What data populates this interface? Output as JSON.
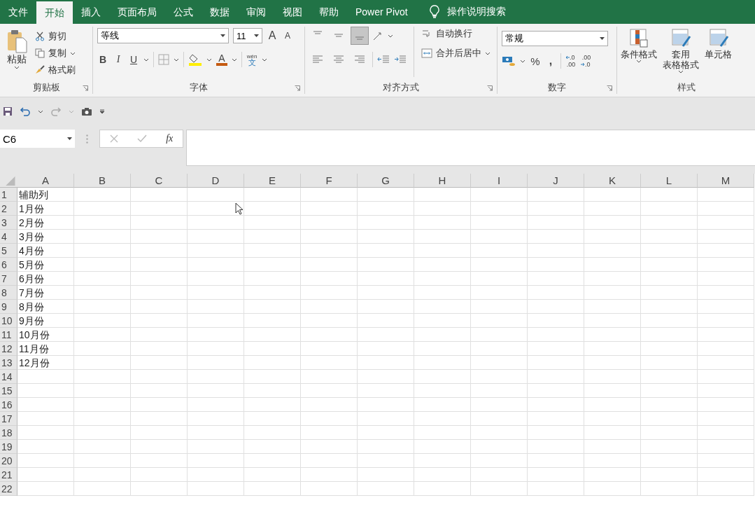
{
  "tabs": [
    {
      "label": "文件",
      "selected": false
    },
    {
      "label": "开始",
      "selected": true
    },
    {
      "label": "插入",
      "selected": false
    },
    {
      "label": "页面布局",
      "selected": false
    },
    {
      "label": "公式",
      "selected": false
    },
    {
      "label": "数据",
      "selected": false
    },
    {
      "label": "审阅",
      "selected": false
    },
    {
      "label": "视图",
      "selected": false
    },
    {
      "label": "帮助",
      "selected": false
    },
    {
      "label": "Power Pivot",
      "selected": false
    }
  ],
  "tell_me": {
    "text": "操作说明搜索"
  },
  "ribbon": {
    "clipboard": {
      "paste": "粘贴",
      "items": [
        "剪切",
        "复制",
        "格式刷"
      ],
      "title": "剪贴板"
    },
    "font": {
      "font_name": "等线",
      "font_size": "11",
      "grow": "A",
      "shrink": "A",
      "bold": "B",
      "italic": "I",
      "underline": "U",
      "font_color": "A",
      "phonetic_top": "wén",
      "phonetic_bottom": "文",
      "title": "字体"
    },
    "alignment": {
      "wrap": "自动换行",
      "merge": "合并后居中",
      "title": "对齐方式"
    },
    "number": {
      "format": "常规",
      "percent": "%",
      "comma": ",",
      "increase_decimal": [
        ".0",
        ".00"
      ],
      "decrease_decimal": [
        ".00",
        ".0"
      ],
      "title": "数字"
    },
    "styles": {
      "buttons": [
        [
          "条件格式"
        ],
        [
          "套用",
          "表格格式"
        ],
        [
          "单元格"
        ]
      ],
      "title": "样式"
    }
  },
  "name_box": {
    "value": "C6"
  },
  "formula_bar": {
    "fx": "fx"
  },
  "sheet": {
    "columns": [
      "A",
      "B",
      "C",
      "D",
      "E",
      "F",
      "G",
      "H",
      "I",
      "J",
      "K",
      "L",
      "M"
    ],
    "rows": [
      {
        "number": "1",
        "a": "辅助列"
      },
      {
        "number": "2",
        "a": "1月份"
      },
      {
        "number": "3",
        "a": "2月份"
      },
      {
        "number": "4",
        "a": "3月份"
      },
      {
        "number": "5",
        "a": "4月份"
      },
      {
        "number": "6",
        "a": "5月份"
      },
      {
        "number": "7",
        "a": "6月份"
      },
      {
        "number": "8",
        "a": "7月份"
      },
      {
        "number": "9",
        "a": "8月份"
      },
      {
        "number": "10",
        "a": "9月份"
      },
      {
        "number": "11",
        "a": "10月份"
      },
      {
        "number": "12",
        "a": "11月份"
      },
      {
        "number": "13",
        "a": "12月份"
      },
      {
        "number": "14"
      },
      {
        "number": "15"
      },
      {
        "number": "16"
      },
      {
        "number": "17"
      },
      {
        "number": "18"
      },
      {
        "number": "19"
      },
      {
        "number": "20"
      },
      {
        "number": "21"
      },
      {
        "number": "22"
      }
    ]
  }
}
